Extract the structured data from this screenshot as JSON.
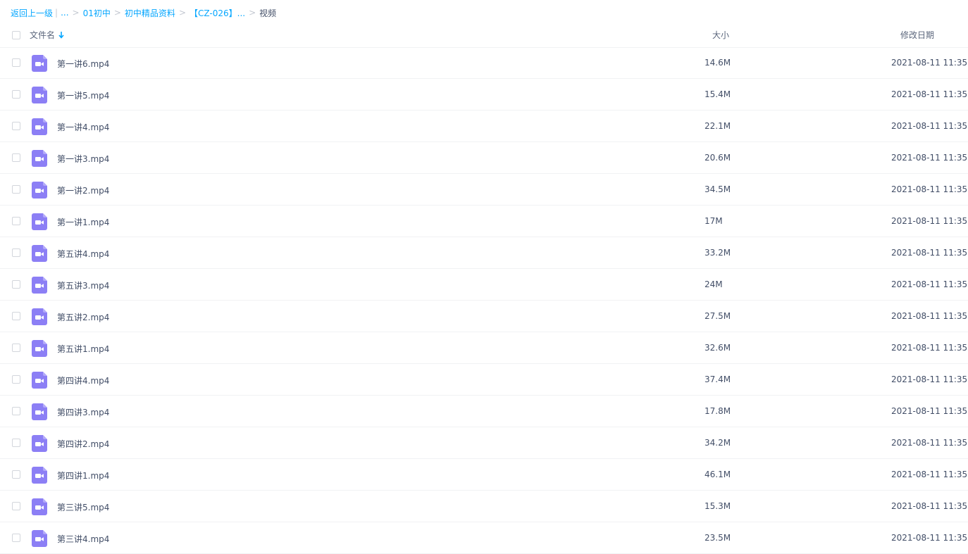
{
  "breadcrumb": {
    "back": "返回上一级",
    "ellipsis": "...",
    "items": [
      "01初中",
      "初中精品资料",
      "【CZ-026】..."
    ],
    "current": "视频",
    "separator": ">"
  },
  "header": {
    "name": "文件名",
    "size": "大小",
    "date": "修改日期",
    "sort": "descending"
  },
  "colors": {
    "link": "#06a7ff",
    "video_icon": "#8c7ff5"
  },
  "files": [
    {
      "name": "第一讲6.mp4",
      "size": "14.6M",
      "date": "2021-08-11 11:35",
      "icon": "video-file-icon"
    },
    {
      "name": "第一讲5.mp4",
      "size": "15.4M",
      "date": "2021-08-11 11:35",
      "icon": "video-file-icon"
    },
    {
      "name": "第一讲4.mp4",
      "size": "22.1M",
      "date": "2021-08-11 11:35",
      "icon": "video-file-icon"
    },
    {
      "name": "第一讲3.mp4",
      "size": "20.6M",
      "date": "2021-08-11 11:35",
      "icon": "video-file-icon"
    },
    {
      "name": "第一讲2.mp4",
      "size": "34.5M",
      "date": "2021-08-11 11:35",
      "icon": "video-file-icon"
    },
    {
      "name": "第一讲1.mp4",
      "size": "17M",
      "date": "2021-08-11 11:35",
      "icon": "video-file-icon"
    },
    {
      "name": "第五讲4.mp4",
      "size": "33.2M",
      "date": "2021-08-11 11:35",
      "icon": "video-file-icon"
    },
    {
      "name": "第五讲3.mp4",
      "size": "24M",
      "date": "2021-08-11 11:35",
      "icon": "video-file-icon"
    },
    {
      "name": "第五讲2.mp4",
      "size": "27.5M",
      "date": "2021-08-11 11:35",
      "icon": "video-file-icon"
    },
    {
      "name": "第五讲1.mp4",
      "size": "32.6M",
      "date": "2021-08-11 11:35",
      "icon": "video-file-icon"
    },
    {
      "name": "第四讲4.mp4",
      "size": "37.4M",
      "date": "2021-08-11 11:35",
      "icon": "video-file-icon"
    },
    {
      "name": "第四讲3.mp4",
      "size": "17.8M",
      "date": "2021-08-11 11:35",
      "icon": "video-file-icon"
    },
    {
      "name": "第四讲2.mp4",
      "size": "34.2M",
      "date": "2021-08-11 11:35",
      "icon": "video-file-icon"
    },
    {
      "name": "第四讲1.mp4",
      "size": "46.1M",
      "date": "2021-08-11 11:35",
      "icon": "video-file-icon"
    },
    {
      "name": "第三讲5.mp4",
      "size": "15.3M",
      "date": "2021-08-11 11:35",
      "icon": "video-file-icon"
    },
    {
      "name": "第三讲4.mp4",
      "size": "23.5M",
      "date": "2021-08-11 11:35",
      "icon": "video-file-icon"
    }
  ]
}
